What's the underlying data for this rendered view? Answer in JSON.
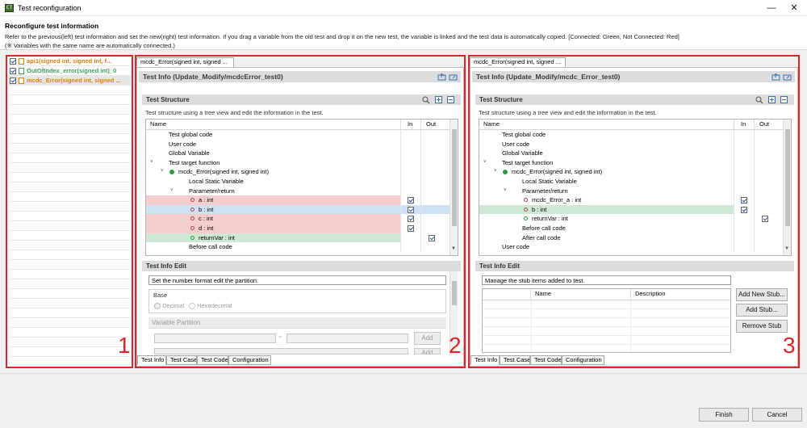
{
  "window": {
    "title": "Test reconfiguration",
    "icon_text": "CT"
  },
  "header": {
    "title": "Reconfigure test information",
    "description": "Refer to the previous(left) test information and set the new(right) test information. If you drag a variable from the old test and drop it on the new test, the variable is linked and the test data is automatically copied. [Connected: Green, Not Connected: Red]",
    "note": "(※ Variables with the same name are automatically connected.)"
  },
  "left_list": {
    "items": [
      {
        "label": "api1(signed int, signed int, f...",
        "color": "#e07d10",
        "checked": true
      },
      {
        "label": "OutOfIndex_error(signed int)_0",
        "color": "#3aa556",
        "checked": true
      },
      {
        "label": "mcdc_Error(signed int, signed ...",
        "color": "#e07d10",
        "checked": true
      }
    ]
  },
  "panel_numbers": {
    "p1": "1",
    "p2": "2",
    "p3": "3"
  },
  "middle": {
    "tab_label": "mcdc_Error(signed int, signed ...",
    "info_title": "Test Info (Update_Modify/mcdcError_test0)",
    "structure_title": "Test Structure",
    "structure_hint": "Test structure using a tree view and edit the information in the test.",
    "columns": {
      "name": "Name",
      "in": "In",
      "out": "Out"
    },
    "rows": [
      {
        "label": "Test global code",
        "indent": 28,
        "bg": "",
        "in": false,
        "out": false
      },
      {
        "label": "User code",
        "indent": 28,
        "bg": "",
        "in": false,
        "out": false
      },
      {
        "label": "Global Variable",
        "indent": 28,
        "bg": "",
        "in": false,
        "out": false
      },
      {
        "label": "Test target function",
        "indent": 28,
        "bg": "",
        "in": false,
        "out": false
      },
      {
        "label": "mcdc_Error(signed int, signed int)",
        "indent": 40,
        "bg": "",
        "in": false,
        "out": false
      },
      {
        "label": "Local Static Variable",
        "indent": 53,
        "bg": "",
        "in": false,
        "out": false
      },
      {
        "label": "Parameter/return",
        "indent": 53,
        "bg": "",
        "in": false,
        "out": false
      },
      {
        "label": "a  :  int",
        "indent": 65,
        "bg": "pink",
        "in": true,
        "out": false
      },
      {
        "label": "b  :  int",
        "indent": 65,
        "bg": "blue",
        "in": true,
        "out": false
      },
      {
        "label": "c  :  int",
        "indent": 65,
        "bg": "pink",
        "in": true,
        "out": false
      },
      {
        "label": "d  :  int",
        "indent": 65,
        "bg": "pink",
        "in": true,
        "out": false
      },
      {
        "label": "returnVar  :  int",
        "indent": 65,
        "bg": "green",
        "in": false,
        "out": true
      },
      {
        "label": "Before call code",
        "indent": 53,
        "bg": "",
        "in": false,
        "out": false
      }
    ],
    "edit_title": "Test Info Edit",
    "edit_hint": "Set the number format edit the partition.",
    "base_label": "Base",
    "radio_decimal": "Decimal",
    "radio_hex": "Hexadecimal",
    "partition_label": "Variable Partition",
    "dash": "~",
    "add_label": "Add",
    "bottom_tabs": [
      "Test Info",
      "Test Case",
      "Test Code",
      "Configuration"
    ]
  },
  "right": {
    "tab_label": "mcdc_Error(signed int, signed ...",
    "info_title": "Test Info (Update_Modify/mcdc_Error_test0)",
    "structure_title": "Test Structure",
    "structure_hint": "Test structure using a tree view and edit the information in the test.",
    "columns": {
      "name": "Name",
      "in": "In",
      "out": "Out"
    },
    "rows": [
      {
        "label": "Test global code",
        "indent": 28,
        "bg": "",
        "in": false,
        "out": false
      },
      {
        "label": "User code",
        "indent": 28,
        "bg": "",
        "in": false,
        "out": false
      },
      {
        "label": "Global Variable",
        "indent": 28,
        "bg": "",
        "in": false,
        "out": false
      },
      {
        "label": "Test target function",
        "indent": 28,
        "bg": "",
        "in": false,
        "out": false
      },
      {
        "label": "mcdc_Error(signed int, signed int)",
        "indent": 40,
        "bg": "",
        "in": false,
        "out": false
      },
      {
        "label": "Local Static Variable",
        "indent": 53,
        "bg": "",
        "in": false,
        "out": false
      },
      {
        "label": "Parameter/return",
        "indent": 53,
        "bg": "",
        "in": false,
        "out": false
      },
      {
        "label": "mcdc_Error_a  :  int",
        "indent": 65,
        "bg": "",
        "in": true,
        "out": false
      },
      {
        "label": "b  :  int",
        "indent": 65,
        "bg": "green",
        "in": true,
        "out": false
      },
      {
        "label": "returnVar  :  int",
        "indent": 65,
        "bg": "",
        "in": false,
        "out": true
      },
      {
        "label": "Before call code",
        "indent": 53,
        "bg": "",
        "in": false,
        "out": false
      },
      {
        "label": "After call code",
        "indent": 53,
        "bg": "",
        "in": false,
        "out": false
      },
      {
        "label": "User code",
        "indent": 28,
        "bg": "",
        "in": false,
        "out": false
      }
    ],
    "edit_title": "Test Info Edit",
    "edit_hint": "Manage the stub items added to test.",
    "stub_columns": {
      "name": "Name",
      "description": "Description"
    },
    "buttons": {
      "add_new": "Add New Stub...",
      "add": "Add Stub...",
      "remove": "Remove Stub"
    },
    "bottom_tabs": [
      "Test Info",
      "Test Case",
      "Test Code",
      "Configuration"
    ]
  },
  "footer": {
    "finish": "Finish",
    "cancel": "Cancel"
  },
  "colors": {
    "frame_red": "#e0242e",
    "connected": "#cfe8d5",
    "not_connected": "#f5cdcd",
    "selected": "#cfe2f5"
  }
}
